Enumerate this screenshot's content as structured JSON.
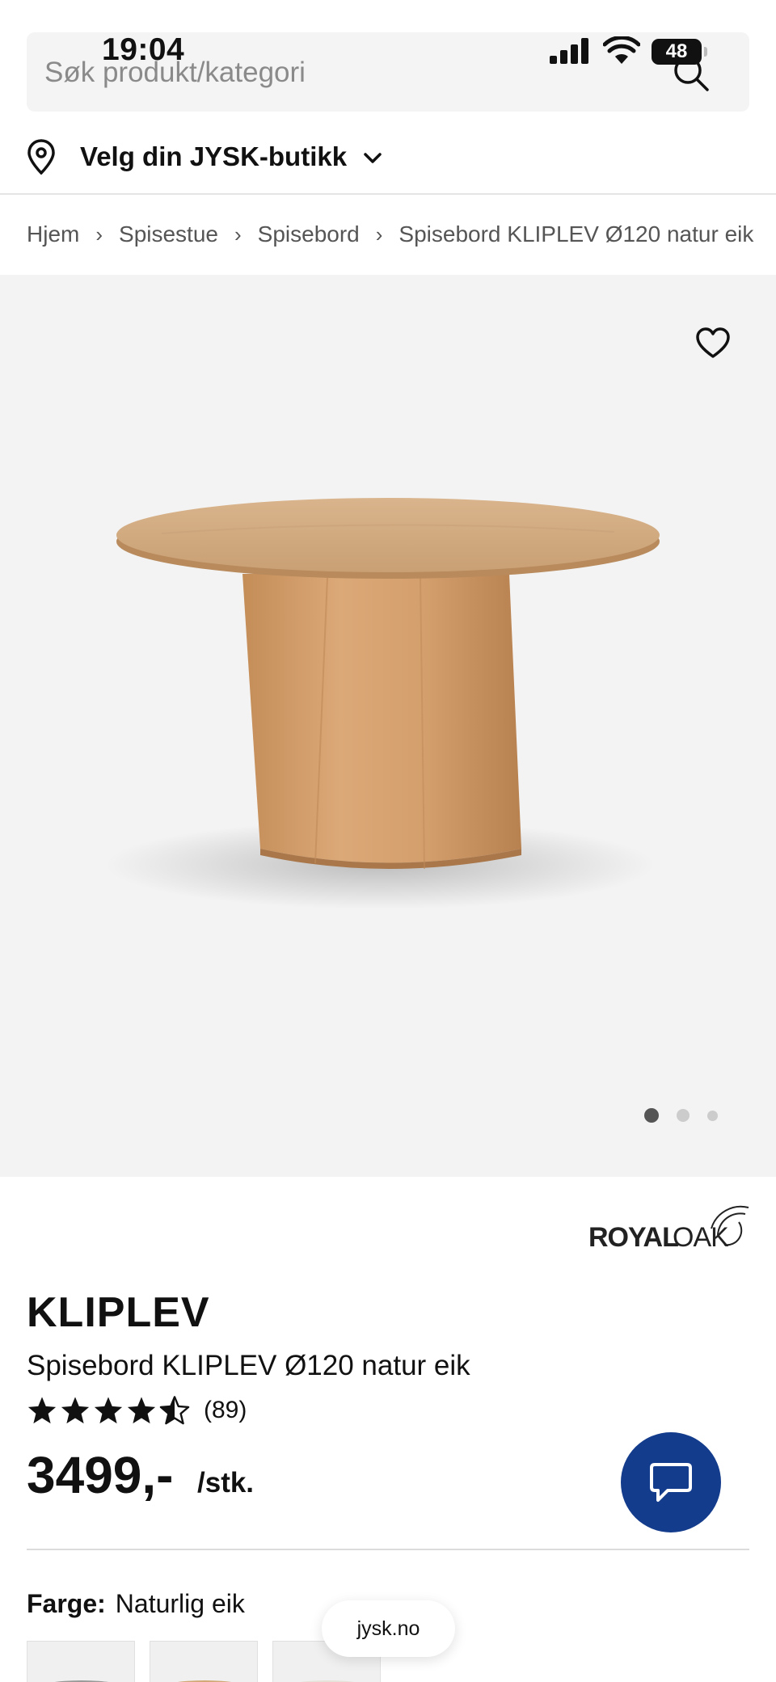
{
  "status_bar": {
    "time": "19:04",
    "battery": "48"
  },
  "search": {
    "placeholder": "Søk produkt/kategori"
  },
  "store": {
    "label": "Velg din JYSK-butikk"
  },
  "breadcrumb": [
    "Hjem",
    "Spisestue",
    "Spisebord",
    "Spisebord KLIPLEV Ø120 natur eik"
  ],
  "gallery": {
    "image_count": 3,
    "active_index": 0
  },
  "brand": {
    "name": "ROYAL OAK"
  },
  "product": {
    "name": "KLIPLEV",
    "subtitle": "Spisebord KLIPLEV Ø120 natur eik",
    "rating_stars": 4.5,
    "rating_max": 5,
    "rating_count": "(89)",
    "price": "3499,-",
    "unit": "/stk."
  },
  "color": {
    "label": "Farge:",
    "value": "Naturlig eik"
  },
  "browser": {
    "url": "jysk.no"
  },
  "colors": {
    "accent": "#143c8c",
    "background": "#ffffff",
    "image_bg": "#f3f3f3"
  }
}
